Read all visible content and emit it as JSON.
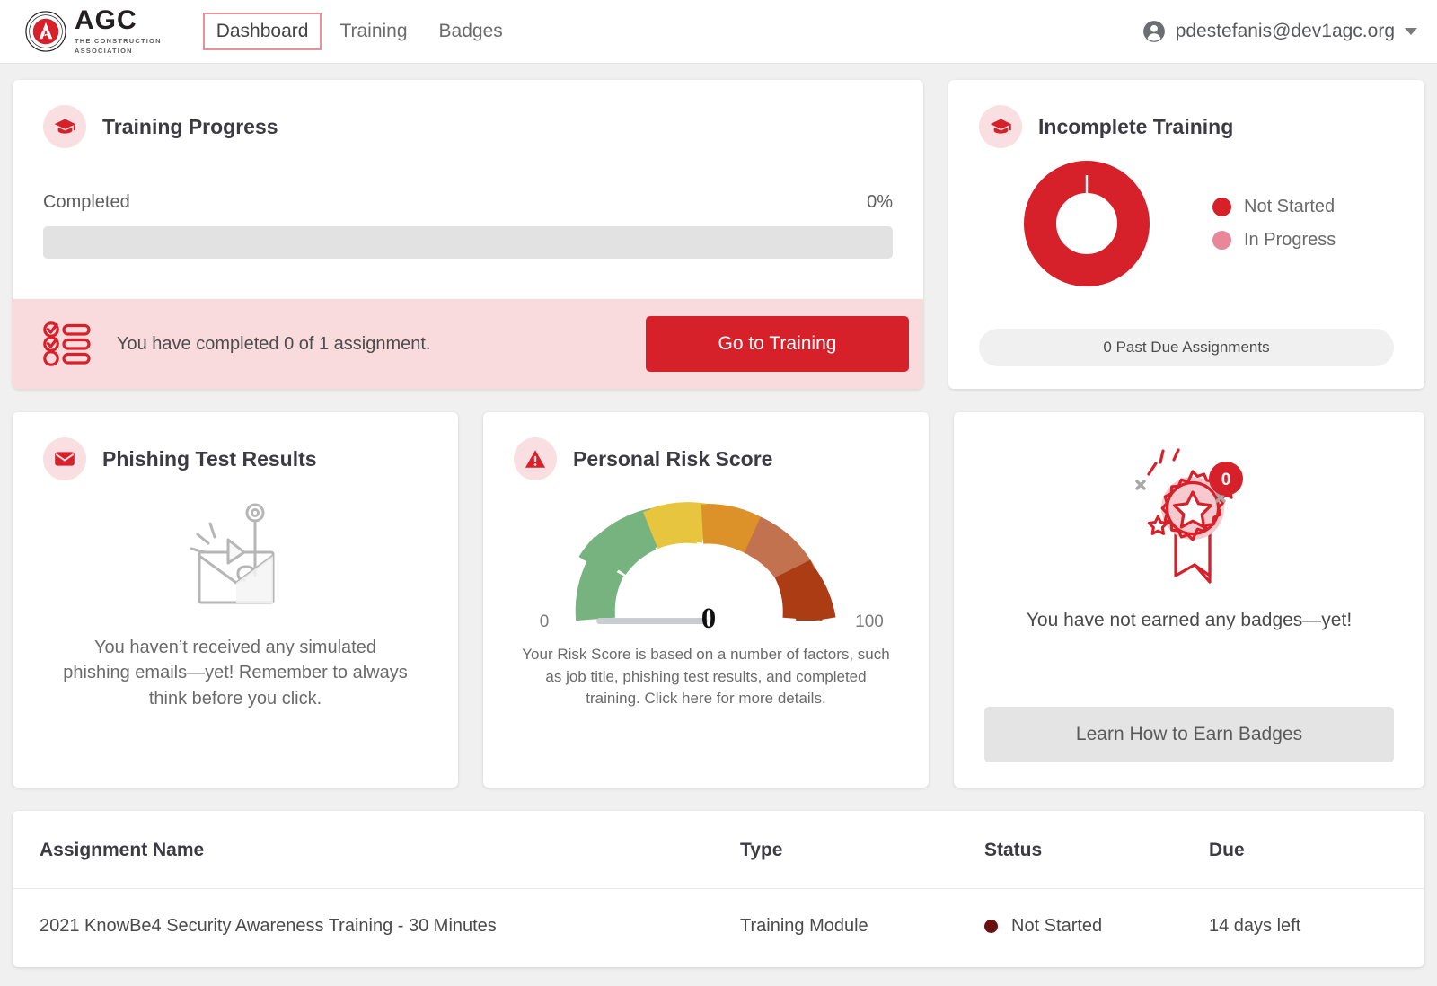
{
  "brand": {
    "name": "AGC",
    "tagline_line1": "THE CONSTRUCTION",
    "tagline_line2": "ASSOCIATION",
    "seal_icon": "agc-seal-icon",
    "seal_color": "#d6202a"
  },
  "nav": {
    "items": [
      {
        "label": "Dashboard",
        "active": true
      },
      {
        "label": "Training",
        "active": false
      },
      {
        "label": "Badges",
        "active": false
      }
    ],
    "active_outline_color": "#e8919d"
  },
  "account": {
    "email": "pdestefanis@dev1agc.org",
    "avatar_icon": "user-circle-icon",
    "caret_icon": "chevron-down-icon"
  },
  "training_progress": {
    "title": "Training Progress",
    "icon": "graduation-cap-icon",
    "completed_label": "Completed",
    "percent_label": "0%",
    "percent_value": 0,
    "banner_icon": "checklist-icon",
    "banner_text": "You have completed 0 of 1 assignment.",
    "button_label": "Go to Training",
    "button_color": "#d6202a",
    "banner_bg": "#f9dadd"
  },
  "incomplete_training": {
    "title": "Incomplete Training",
    "icon": "graduation-cap-icon",
    "legend": [
      {
        "label": "Not Started",
        "color": "#d6202a"
      },
      {
        "label": "In Progress",
        "color": "#e8879a"
      }
    ],
    "past_due_label": "0 Past Due Assignments"
  },
  "phishing": {
    "title": "Phishing Test Results",
    "icon": "envelope-icon",
    "art_icon": "phishing-hook-envelope-icon",
    "empty_text": "You haven’t received any simulated phishing emails—yet! Remember to always think before you click."
  },
  "risk_score": {
    "title": "Personal Risk Score",
    "icon": "warning-triangle-icon",
    "min_label": "0",
    "max_label": "100",
    "value_label": "0",
    "note": "Your Risk Score is based on a number of factors, such as job title, phishing test results, and completed training. Click here for more details."
  },
  "badges": {
    "art_icon": "ribbon-award-icon",
    "count_badge": "0",
    "message": "You have not earned any badges—yet!",
    "button_label": "Learn How to Earn Badges"
  },
  "assignments": {
    "columns": [
      "Assignment Name",
      "Type",
      "Status",
      "Due"
    ],
    "rows": [
      {
        "name": "2021 KnowBe4 Security Awareness Training - 30 Minutes",
        "type": "Training Module",
        "status": "Not Started",
        "status_color": "#6b0f10",
        "due": "14 days left"
      }
    ]
  },
  "chart_data": [
    {
      "type": "pie",
      "title": "Incomplete Training",
      "labels": [
        "Not Started",
        "In Progress"
      ],
      "values": [
        1,
        0
      ],
      "colors": [
        "#d6202a",
        "#e8879a"
      ],
      "donut": true,
      "legend_position": "right"
    },
    {
      "type": "bar",
      "title": "Training Progress",
      "categories": [
        "Completed"
      ],
      "values": [
        0
      ],
      "ylabel": "",
      "xlabel": "",
      "ylim": [
        0,
        100
      ],
      "value_labels": [
        "0%"
      ]
    },
    {
      "type": "gauge",
      "title": "Personal Risk Score",
      "value": 0,
      "xlim": [
        0,
        100
      ],
      "tick_labels": [
        "0",
        "100"
      ],
      "bands": [
        {
          "from": 0,
          "to": 20,
          "color": "#77b37f"
        },
        {
          "from": 20,
          "to": 40,
          "color": "#e8c53f"
        },
        {
          "from": 40,
          "to": 60,
          "color": "#dd9229"
        },
        {
          "from": 60,
          "to": 80,
          "color": "#c2724f"
        },
        {
          "from": 80,
          "to": 100,
          "color": "#ab3c14"
        }
      ],
      "needle_color": "#c9ccd1"
    }
  ]
}
